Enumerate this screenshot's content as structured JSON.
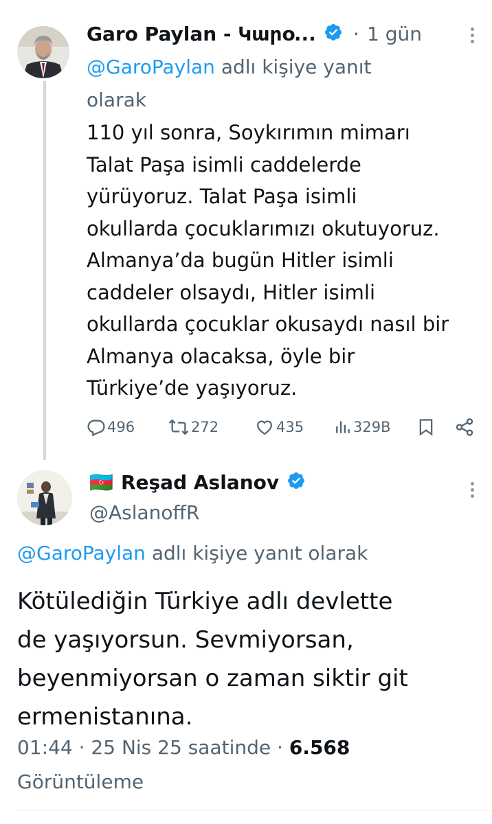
{
  "reply_tweet": {
    "author_name": "Garo Paylan - Կարօ...",
    "separator": "·",
    "time": "1 gün",
    "reply_to_handle": "@GaroPaylan",
    "reply_to_suffix": "adlı kişiye yanıt",
    "reply_to_suffix2": "olarak",
    "text": "110 yıl sonra, Soykırımın mimarı\nTalat Paşa isimli caddelerde\nyürüyoruz. Talat Paşa isimli\nokullarda çocuklarımızı okutuyoruz.\nAlmanya’da bugün Hitler isimli\ncaddeler olsaydı, Hitler isimli\nokullarda çocuklar okusaydı nasıl bir\nAlmanya olacaksa, öyle bir\nTürkiye’de yaşıyoruz.",
    "stats": {
      "replies": "496",
      "retweets": "272",
      "likes": "435",
      "views": "329B"
    },
    "verified_color": "#1d9bf0"
  },
  "main_tweet": {
    "flag": "🇦🇿",
    "author_name": "Reşad Aslanov",
    "handle": "@AslanoffR",
    "reply_to_handle": "@GaroPaylan",
    "reply_to_suffix": "adlı kişiye yanıt olarak",
    "text": "Kötülediğin Türkiye adlı devlette\nde yaşıyorsun. Sevmiyorsan,\nbeyenmiyorsan o zaman siktir git\nermenistanına.",
    "time": "01:44",
    "date": "25 Nis 25 saatinde",
    "view_count": "6.568",
    "view_label": "Görüntüleme"
  },
  "colors": {
    "link": "#1d9bf0",
    "muted": "#536471",
    "text": "#0f1419"
  }
}
